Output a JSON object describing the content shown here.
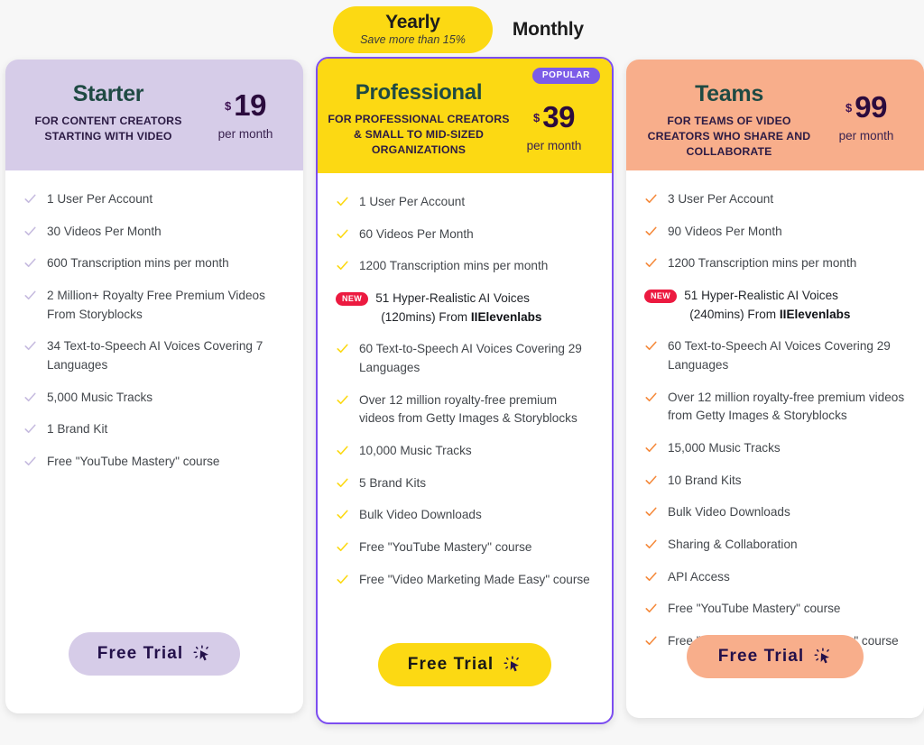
{
  "billing_toggle": {
    "selected": "Yearly",
    "yearly_label": "Yearly",
    "yearly_sublabel": "Save more than 15%",
    "monthly_label": "Monthly"
  },
  "currency_symbol": "$",
  "cta_label": "Free Trial",
  "colors": {
    "page_background": "#f7f7f7",
    "starter_header": "#D6CCE8",
    "professional_header": "#FCD913",
    "teams_header": "#F8AE8B",
    "professional_border": "#7C4DF0",
    "popular_badge": "#7C5CE8",
    "new_badge": "#EC1A40",
    "plan_name": "#1F4A43",
    "price": "#2B0B3D",
    "starter_check": "#C6BBDF",
    "professional_check": "#FCD913",
    "teams_check": "#F58A3C"
  },
  "plans": [
    {
      "id": "starter",
      "name": "Starter",
      "tagline": "FOR CONTENT CREATORS STARTING WITH VIDEO",
      "price": "19",
      "period": "per month",
      "badge": null,
      "check_color": "#C6BBDF",
      "cta_label": "Free Trial",
      "features": [
        {
          "text": "1 User Per Account",
          "badge": null
        },
        {
          "text": "30 Videos Per Month",
          "badge": null
        },
        {
          "text": "600 Transcription mins per month",
          "badge": null
        },
        {
          "text": "2 Million+ Royalty Free Premium Videos From Storyblocks",
          "badge": null
        },
        {
          "text": "34 Text-to-Speech AI Voices Covering 7 Languages",
          "badge": null
        },
        {
          "text": "5,000 Music Tracks",
          "badge": null
        },
        {
          "text": "1 Brand Kit",
          "badge": null
        },
        {
          "text": "Free \"YouTube Mastery\" course",
          "badge": null
        }
      ]
    },
    {
      "id": "professional",
      "name": "Professional",
      "tagline": "FOR PROFESSIONAL CREATORS & SMALL TO MID-SIZED ORGANIZATIONS",
      "price": "39",
      "period": "per month",
      "badge": "POPULAR",
      "check_color": "#FCD913",
      "cta_label": "Free Trial",
      "features": [
        {
          "text": "1 User Per Account",
          "badge": null
        },
        {
          "text": "60 Videos Per Month",
          "badge": null
        },
        {
          "text": "1200 Transcription mins per month",
          "badge": null
        },
        {
          "text": "51 Hyper-Realistic AI Voices",
          "sub_prefix": "(120mins) From ",
          "sub_brand": "IIElevenlabs",
          "badge": "NEW"
        },
        {
          "text": "60 Text-to-Speech AI Voices Covering 29 Languages",
          "badge": null
        },
        {
          "text": "Over 12 million royalty-free premium videos from Getty Images & Storyblocks",
          "badge": null
        },
        {
          "text": "10,000 Music Tracks",
          "badge": null
        },
        {
          "text": "5 Brand Kits",
          "badge": null
        },
        {
          "text": "Bulk Video Downloads",
          "badge": null
        },
        {
          "text": "Free \"YouTube Mastery\" course",
          "badge": null
        },
        {
          "text": "Free \"Video Marketing Made Easy\" course",
          "badge": null
        }
      ]
    },
    {
      "id": "teams",
      "name": "Teams",
      "tagline": "FOR TEAMS OF VIDEO CREATORS WHO SHARE AND COLLABORATE",
      "price": "99",
      "period": "per month",
      "badge": null,
      "check_color": "#F58A3C",
      "cta_label": "Free Trial",
      "features": [
        {
          "text": "3 User Per Account",
          "badge": null
        },
        {
          "text": "90 Videos Per Month",
          "badge": null
        },
        {
          "text": "1200 Transcription mins per month",
          "badge": null
        },
        {
          "text": "51 Hyper-Realistic AI Voices",
          "sub_prefix": "(240mins) From ",
          "sub_brand": "IIElevenlabs",
          "badge": "NEW"
        },
        {
          "text": "60 Text-to-Speech AI Voices Covering 29 Languages",
          "badge": null
        },
        {
          "text": "Over 12 million royalty-free premium videos from Getty Images & Storyblocks",
          "badge": null
        },
        {
          "text": "15,000 Music Tracks",
          "badge": null
        },
        {
          "text": "10 Brand Kits",
          "badge": null
        },
        {
          "text": "Bulk Video Downloads",
          "badge": null
        },
        {
          "text": "Sharing & Collaboration",
          "badge": null
        },
        {
          "text": "API Access",
          "badge": null
        },
        {
          "text": "Free \"YouTube Mastery\" course",
          "badge": null
        },
        {
          "text": "Free \"Video Marketing Made Easy\" course",
          "badge": null
        }
      ]
    }
  ]
}
